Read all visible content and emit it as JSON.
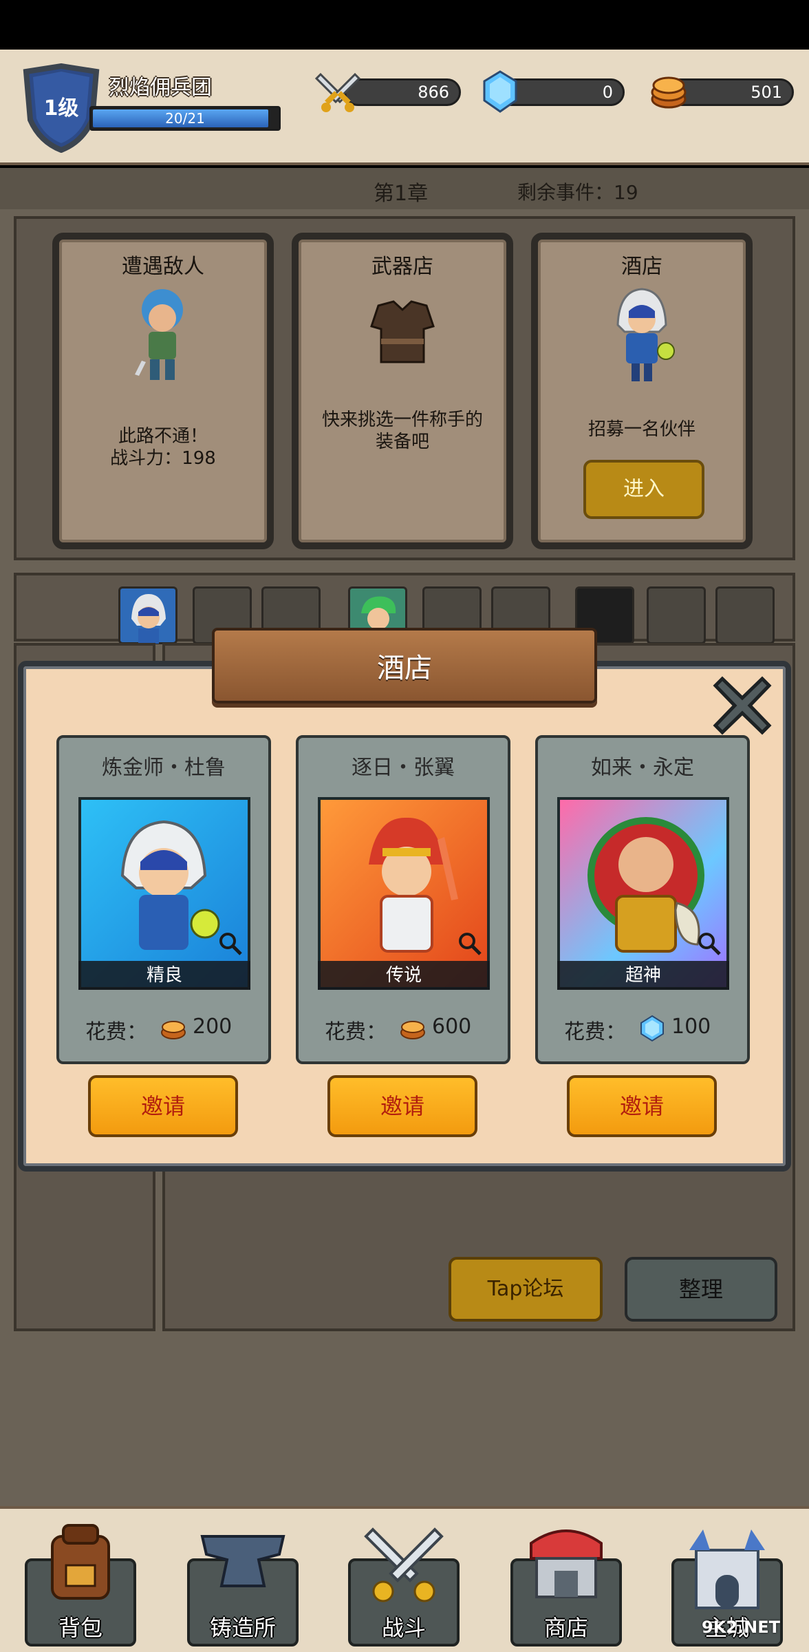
{
  "header": {
    "level": "1级",
    "team_name": "烈焰佣兵团",
    "exp_text": "20/21",
    "exp_fraction": 0.952,
    "power": "866",
    "gems": "0",
    "gold": "501"
  },
  "chapter": {
    "title": "第1章",
    "events_remaining": "剩余事件：19"
  },
  "events": [
    {
      "title": "遭遇敌人",
      "desc_line1": "此路不通！",
      "desc_line2": "战斗力：198"
    },
    {
      "title": "武器店",
      "desc_line1": "快来挑选一件称手的",
      "desc_line2": "装备吧"
    },
    {
      "title": "酒店",
      "desc_line1": "招募一名伙伴",
      "button": "进入"
    }
  ],
  "modal": {
    "title": "酒店",
    "heroes": [
      {
        "name": "炼金师・杜鲁",
        "rarity": "精良",
        "cost_label": "花费：",
        "cost": "200",
        "currency": "gold-icon",
        "button": "邀请",
        "color": "#2aa9e8"
      },
      {
        "name": "逐日・张翼",
        "rarity": "传说",
        "cost_label": "花费：",
        "cost": "600",
        "currency": "gold-icon",
        "button": "邀请",
        "color": "#f07a2a"
      },
      {
        "name": "如来・永定",
        "rarity": "超神",
        "cost_label": "花费：",
        "cost": "100",
        "currency": "gem-icon",
        "button": "邀请",
        "color": "#7c6cf0"
      }
    ]
  },
  "buttons": {
    "tap_forum": "Tap论坛",
    "sort": "整理"
  },
  "nav": [
    {
      "label": "背包",
      "icon": "backpack-icon"
    },
    {
      "label": "铸造所",
      "icon": "anvil-icon"
    },
    {
      "label": "战斗",
      "icon": "crossed-swords-icon"
    },
    {
      "label": "商店",
      "icon": "shop-icon"
    },
    {
      "label": "主城",
      "icon": "castle-icon"
    }
  ],
  "watermark": "9K2.NET"
}
